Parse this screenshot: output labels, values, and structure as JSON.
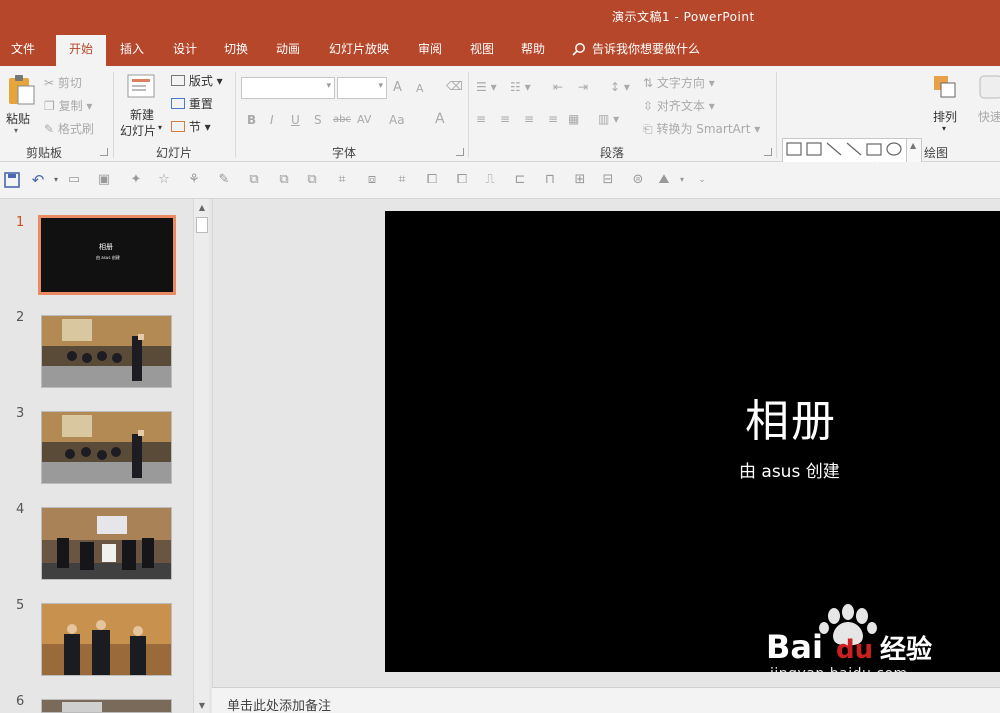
{
  "window": {
    "title": "演示文稿1 - PowerPoint"
  },
  "ribbon_tabs": [
    {
      "label": "文件"
    },
    {
      "label": "开始"
    },
    {
      "label": "插入"
    },
    {
      "label": "设计"
    },
    {
      "label": "切换"
    },
    {
      "label": "动画"
    },
    {
      "label": "幻灯片放映"
    },
    {
      "label": "审阅"
    },
    {
      "label": "视图"
    },
    {
      "label": "帮助"
    }
  ],
  "tell_me": "告诉我你想要做什么",
  "clipboard": {
    "paste": "粘贴",
    "cut": "剪切",
    "copy": "复制",
    "format_painter": "格式刷",
    "group_label": "剪贴板"
  },
  "slides_group": {
    "new_slide_line1": "新建",
    "new_slide_line2": "幻灯片",
    "layout": "版式",
    "reset": "重置",
    "section": "节",
    "group_label": "幻灯片"
  },
  "font_group": {
    "bold": "B",
    "italic": "I",
    "underline": "U",
    "shadow": "S",
    "strike": "abc",
    "spacing": "AV",
    "case": "Aa",
    "font_color": "A",
    "grow": "A",
    "shrink": "A",
    "group_label": "字体"
  },
  "paragraph_group": {
    "text_direction": "文字方向",
    "align_text": "对齐文本",
    "smartart": "转换为 SmartArt",
    "group_label": "段落"
  },
  "drawing_group": {
    "arrange": "排列",
    "quick_styles": "快速样",
    "group_label": "绘图"
  },
  "thumbnails": [
    {
      "num": "1",
      "active": true
    },
    {
      "num": "2",
      "active": false
    },
    {
      "num": "3",
      "active": false
    },
    {
      "num": "4",
      "active": false
    },
    {
      "num": "5",
      "active": false
    },
    {
      "num": "6",
      "active": false
    }
  ],
  "thumb1": {
    "title": "相册",
    "sub": "由 asus 创建"
  },
  "slide": {
    "title": "相册",
    "subtitle": "由 asus 创建"
  },
  "notes_placeholder": "单击此处添加备注",
  "watermark": {
    "brand": "Bai",
    "brand2": "du",
    "brand_cn": "经验",
    "url": "jingyan.baidu.com"
  },
  "colors": {
    "accent": "#b7472a",
    "ribbon_bg": "#f3f3f3",
    "active_thumb_border": "#ea8a62"
  }
}
